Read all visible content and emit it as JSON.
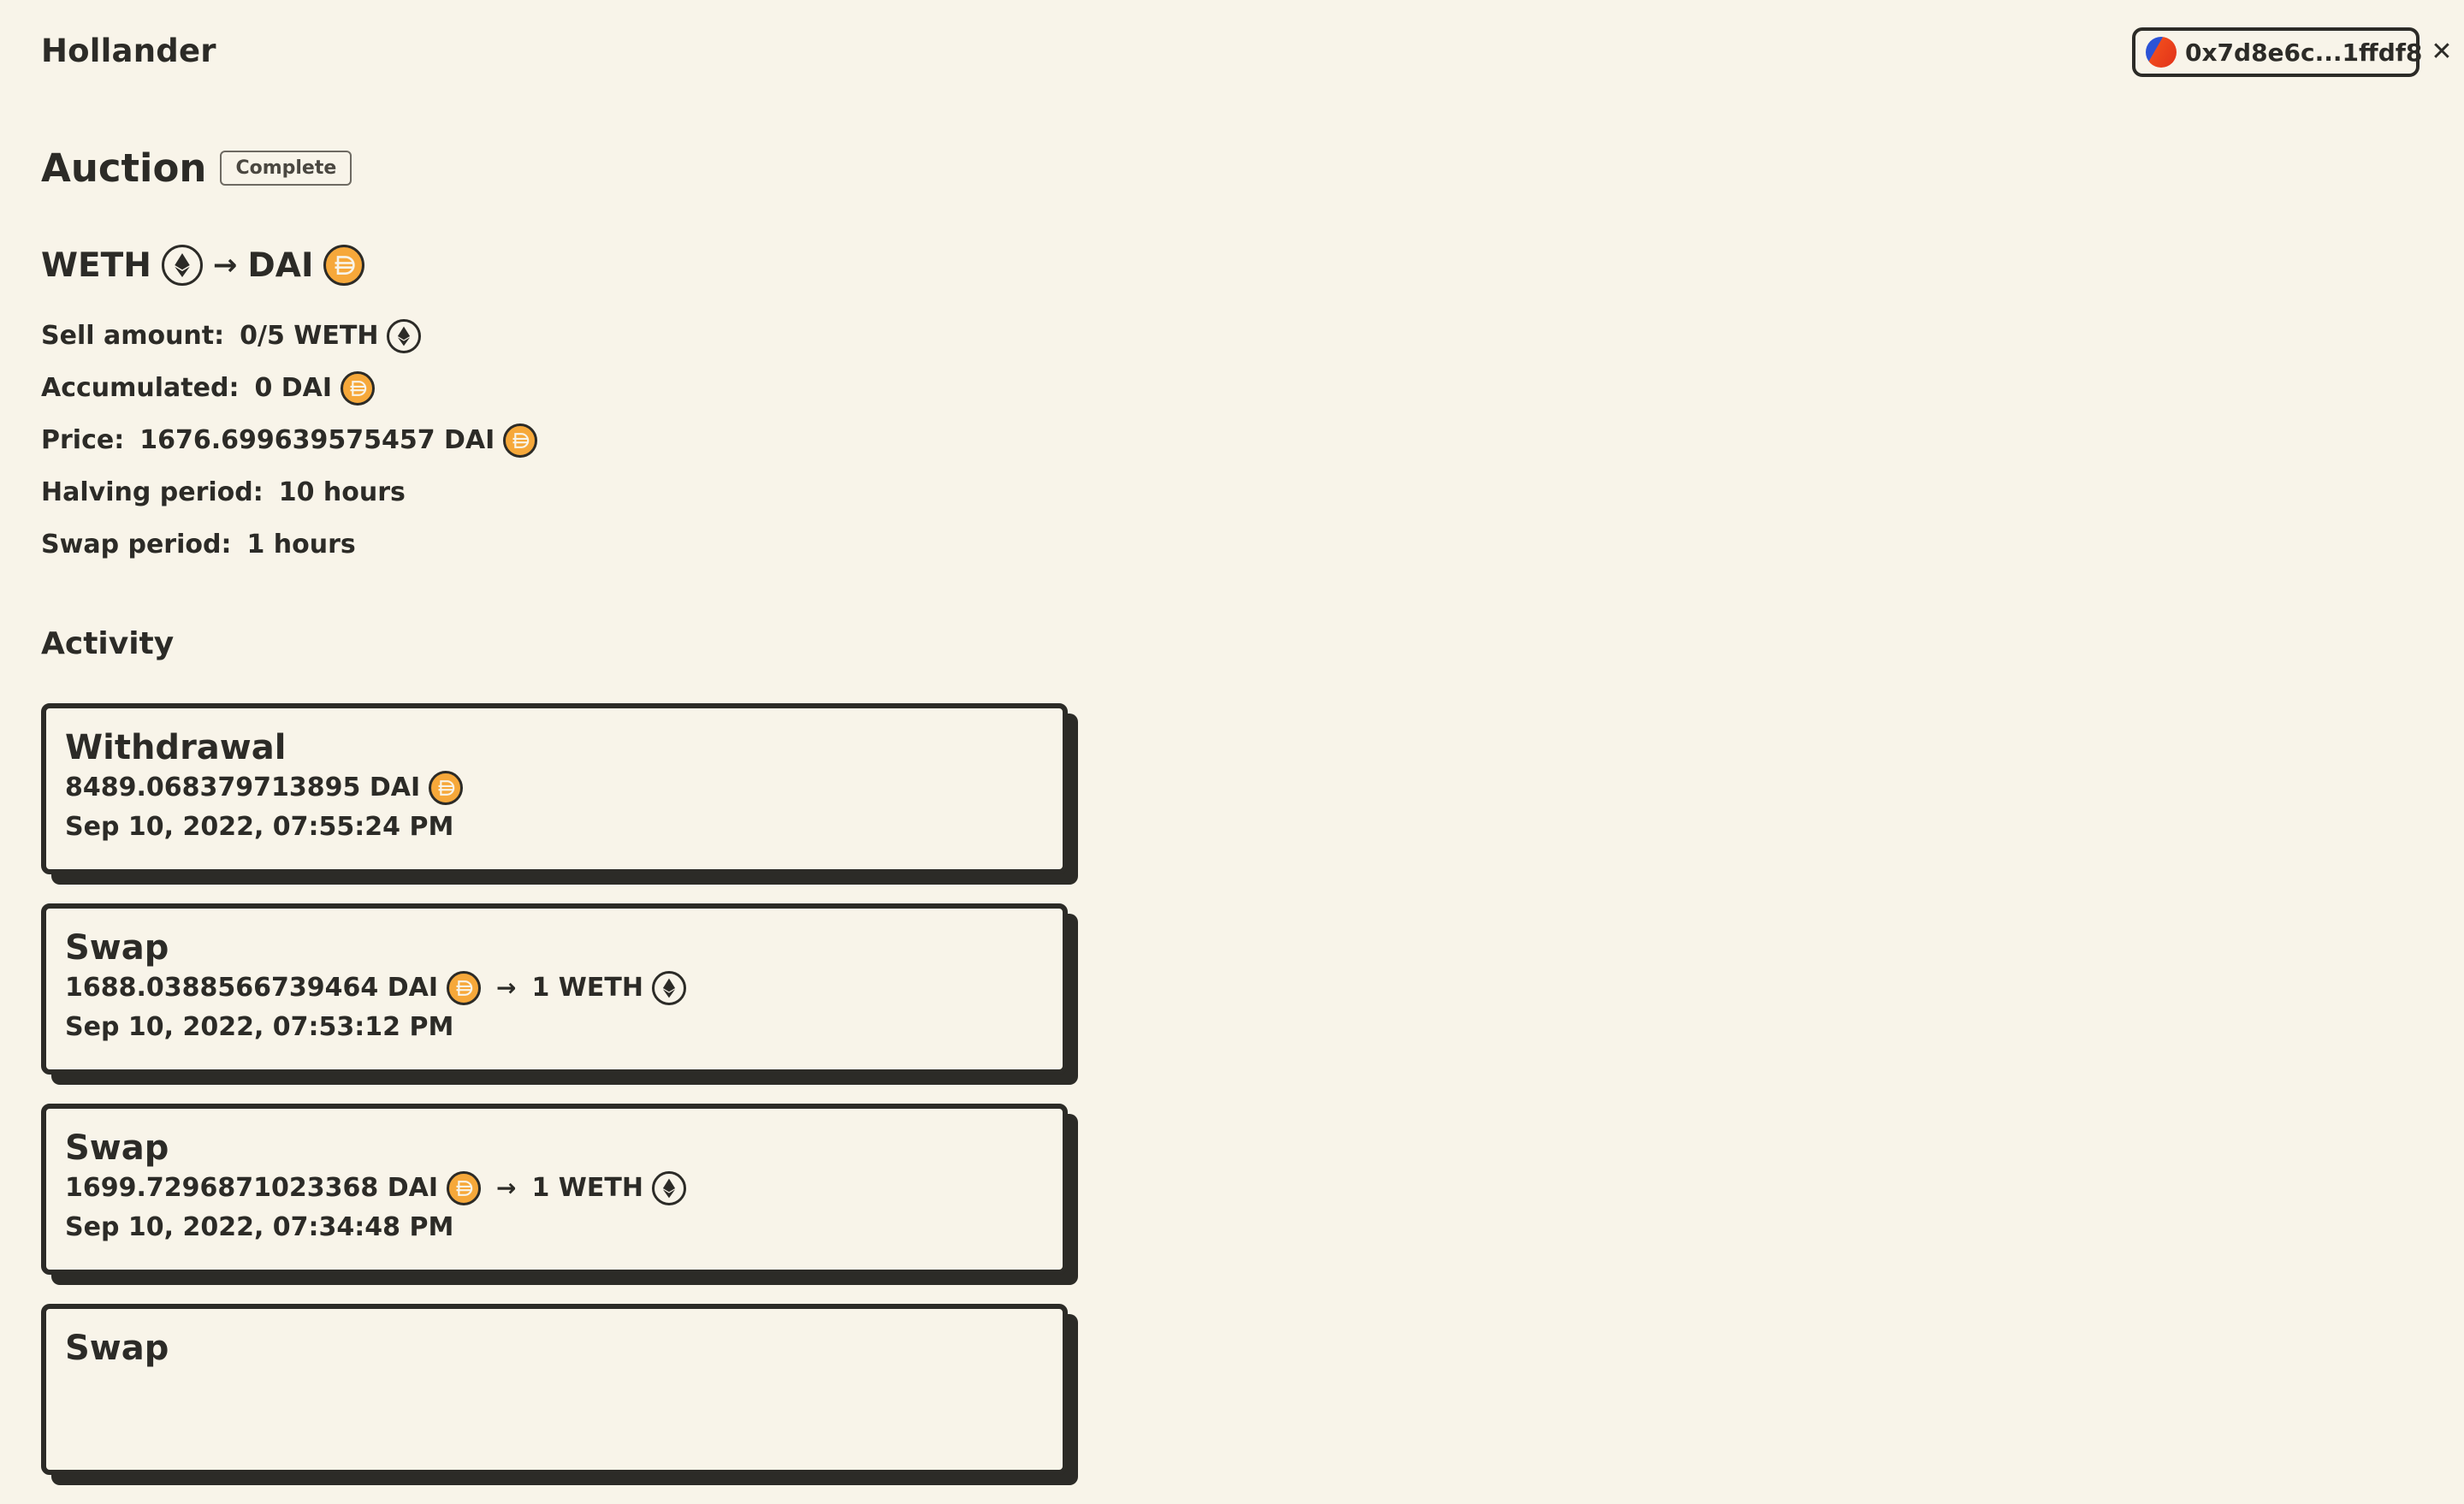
{
  "app": {
    "title": "Hollander"
  },
  "wallet": {
    "address": "0x7d8e6c...1ffdf8"
  },
  "auction": {
    "title": "Auction",
    "status": "Complete",
    "pair": {
      "sell_token": "WETH",
      "buy_token": "DAI"
    },
    "details": [
      {
        "label": "Sell amount:",
        "value": "0/5 WETH",
        "icon": "eth-icon"
      },
      {
        "label": "Accumulated:",
        "value": "0 DAI",
        "icon": "dai-icon"
      },
      {
        "label": "Price:",
        "value": "1676.699639575457 DAI",
        "icon": "dai-icon"
      },
      {
        "label": "Halving period:",
        "value": "10 hours"
      },
      {
        "label": "Swap period:",
        "value": "1 hours"
      }
    ]
  },
  "activity": {
    "title": "Activity",
    "items": [
      {
        "type": "Withdrawal",
        "amount_in": "8489.068379713895 DAI",
        "timestamp": "Sep 10, 2022, 07:55:24 PM"
      },
      {
        "type": "Swap",
        "amount_in": "1688.0388566739464 DAI",
        "amount_out": "1 WETH",
        "timestamp": "Sep 10, 2022, 07:53:12 PM"
      },
      {
        "type": "Swap",
        "amount_in": "1699.7296871023368 DAI",
        "amount_out": "1 WETH",
        "timestamp": "Sep 10, 2022, 07:34:48 PM"
      },
      {
        "type": "Swap"
      }
    ]
  },
  "colors": {
    "background": "#f8f4e9",
    "ink": "#2c2b27",
    "dai": "#f6a83a"
  }
}
